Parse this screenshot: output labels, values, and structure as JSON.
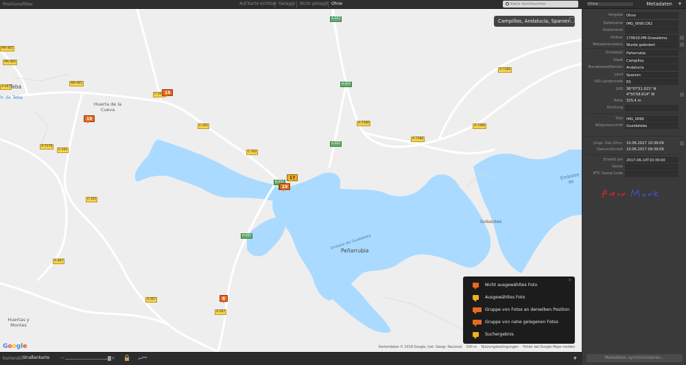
{
  "filter_bar": {
    "title": "Positionsfilter",
    "options": [
      "Auf Karte sichtbar",
      "Getaggt",
      "Nicht getaggt",
      "Ohne"
    ],
    "active_index": 3
  },
  "search": {
    "placeholder": "Karte durchsuchen"
  },
  "map": {
    "location_badge": "Campillos, Andalucía, Spanien",
    "places": [
      {
        "name": "Teba",
        "cls": "big"
      },
      {
        "name": "Huerta de la Cueva",
        "cls": ""
      },
      {
        "name": "Gobantes",
        "cls": ""
      },
      {
        "name": "Peñarrubia",
        "cls": "big"
      },
      {
        "name": "Huertas y Montes",
        "cls": ""
      },
      {
        "name": "lo de Teba",
        "cls": ""
      },
      {
        "name": "Embalse de",
        "cls": ""
      }
    ],
    "road_labels": [
      "A-357",
      "A-357",
      "A-357",
      "A-357",
      "A-7286",
      "A-7286",
      "A-7286",
      "A-7286",
      "C-341",
      "C-341",
      "C-341",
      "C-341",
      "C-341",
      "A-7278",
      "MA-465",
      "MA-465",
      "MA-465",
      "A-367",
      "A-367",
      "A-367",
      "A-367",
      "A-357",
      "A-357"
    ],
    "water_label": "Embalse del Guadalteba",
    "clusters": [
      {
        "label": "15",
        "selected": false
      },
      {
        "label": "19",
        "selected": false
      },
      {
        "label": "17",
        "selected": true
      },
      {
        "label": "19",
        "selected": false
      },
      {
        "label": "6",
        "selected": false
      }
    ],
    "google": "Google",
    "credits": [
      "Kartendaten © 2018 Google, Inst. Geogr. Nacional",
      "500 m",
      "Nutzungsbedingungen",
      "Fehler bei Google Maps melden"
    ]
  },
  "legend": {
    "close": "×",
    "items": [
      {
        "label": "Nicht ausgewähltes Foto",
        "color": "#e8691d"
      },
      {
        "label": "Ausgewähltes Foto",
        "color": "#f3b01e"
      },
      {
        "label": "Gruppe von Fotos an derselben Position",
        "color": "#e8691d"
      },
      {
        "label": "Gruppe von nahe gelegenen Fotos",
        "color": "#e8691d"
      },
      {
        "label": "Suchergebnis",
        "color": "#f3b01e"
      }
    ]
  },
  "bottom_bar": {
    "style_label": "Kartenstil:",
    "style_value": "Straßenkarte",
    "zoom_fraction": 0.97
  },
  "panel": {
    "preset_value": "Ohne",
    "title": "Metadaten",
    "fields": [
      {
        "k": "Vorgabe",
        "v": "Ohne",
        "box": true
      },
      {
        "k": "Dateiname",
        "v": "IMG_0090.CR2",
        "box": true
      },
      {
        "k": "Kopiename",
        "v": "",
        "box": true
      },
      {
        "k": "Ordner",
        "v": "170610-PM-Grazalema",
        "box": true,
        "btn": true
      },
      {
        "k": "Metadatenstatus",
        "v": "Wurde geändert",
        "box": true,
        "btn": true
      },
      {
        "k": "Ortsdetail",
        "v": "Peñarrubia",
        "box": true
      },
      {
        "k": "Stadt",
        "v": "Campillos",
        "box": true
      },
      {
        "k": "Bundesland/Kanton",
        "v": "Andalucía",
        "box": true
      },
      {
        "k": "Land",
        "v": "Spanien",
        "box": true
      },
      {
        "k": "ISO-Ländercode",
        "v": "ES",
        "box": true
      },
      {
        "k": "GPS",
        "v": "36°57'51.021\" N",
        "box": false
      },
      {
        "k": "",
        "v": "4°50'58.814\" W",
        "box": false,
        "btn": true
      },
      {
        "k": "Höhe",
        "v": "325,4 m",
        "box": false
      },
      {
        "k": "Richtung",
        "v": "",
        "box": true
      },
      {
        "k": "Titel",
        "v": "IMG_0090",
        "box": true
      },
      {
        "k": "Bildunterschrift",
        "v": "Gualdateba",
        "box": true
      },
      {
        "k": "Urspr. Dat./Uhrz.",
        "v": "10.06.2017 10:39:09",
        "box": false,
        "btn": true
      },
      {
        "k": "Datum/Uhrzeit",
        "v": "10.06.2017 09:39:09",
        "box": false
      },
      {
        "k": "Erstellt am",
        "v": "2017-06-10T10:39:00",
        "box": true
      },
      {
        "k": "Genre",
        "v": "",
        "box": true
      },
      {
        "k": "IPTC Scene Code",
        "v": "",
        "box": true
      }
    ],
    "signature": "Peter Markwart",
    "sync_button": "Metadaten synchronisieren..."
  },
  "colors": {
    "water": "#aadaff",
    "land": "#eeeeee",
    "road": "#ffffff",
    "accent_orange": "#e8691d",
    "accent_yellow": "#f3b01e"
  }
}
